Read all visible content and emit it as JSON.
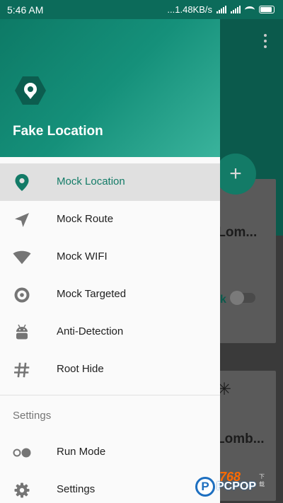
{
  "status_bar": {
    "time": "5:46 AM",
    "network_speed": "...1.48KB/s",
    "battery_level": 0.9
  },
  "background_app": {
    "fab_label": "+",
    "card1_title": ".Lom...",
    "card1_link": "k",
    "card2_icon": "✳",
    "card2_title": "Lomb..."
  },
  "drawer": {
    "app_title": "Fake Location",
    "items": [
      {
        "label": "Mock Location",
        "icon": "location-pin-icon",
        "selected": true
      },
      {
        "label": "Mock Route",
        "icon": "navigation-arrow-icon",
        "selected": false
      },
      {
        "label": "Mock WIFI",
        "icon": "wifi-icon",
        "selected": false
      },
      {
        "label": "Mock Targeted",
        "icon": "target-icon",
        "selected": false
      },
      {
        "label": "Anti-Detection",
        "icon": "android-icon",
        "selected": false
      },
      {
        "label": "Root Hide",
        "icon": "hash-icon",
        "selected": false
      }
    ],
    "settings_section": {
      "title": "Settings",
      "items": [
        {
          "label": "Run Mode",
          "icon": "toggle-dots-icon"
        },
        {
          "label": "Settings",
          "icon": "gear-icon"
        }
      ]
    }
  },
  "watermark": {
    "letter": "P",
    "text": "PCPOP",
    "number": "768",
    "sub": "下载"
  },
  "colors": {
    "primary": "#137b67",
    "header_gradient_end": "#3ab39c",
    "selected_bg": "#e0e0e0"
  }
}
